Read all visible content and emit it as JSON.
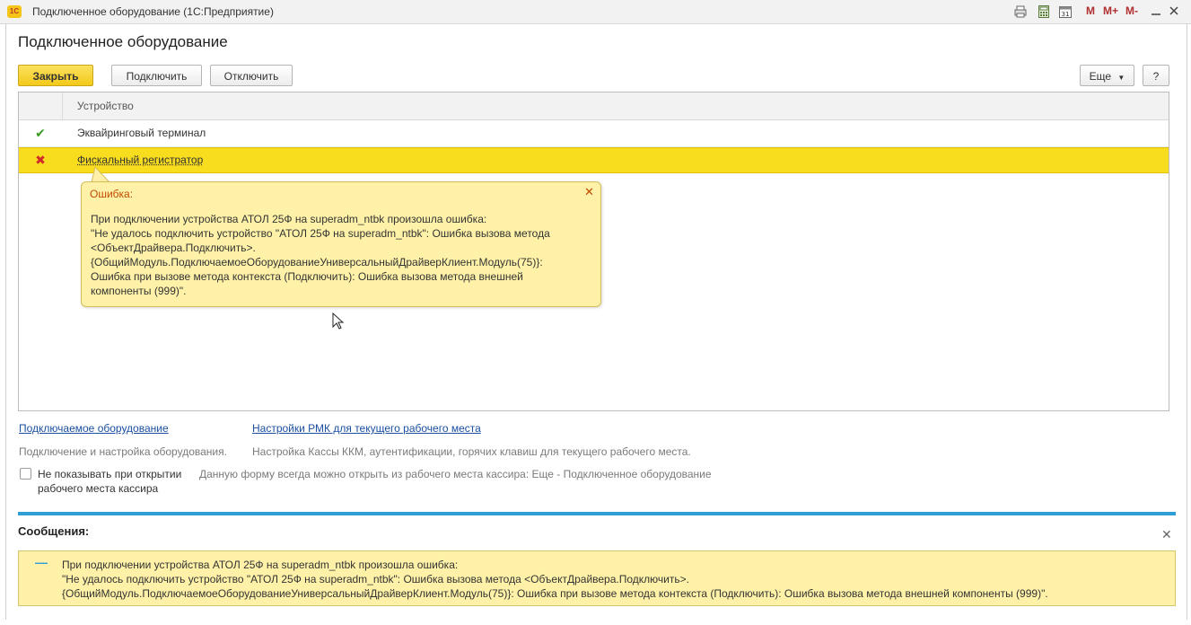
{
  "window": {
    "logo": "1С",
    "title": "Подключенное оборудование  (1С:Предприятие)",
    "toolbar_icons": [
      "print-icon",
      "calculator-icon",
      "calendar-icon"
    ],
    "toolbar_m": "M",
    "toolbar_mplus": "M+",
    "toolbar_mminus": "M-"
  },
  "form": {
    "title": "Подключенное оборудование"
  },
  "toolbar": {
    "close_label": "Закрыть",
    "connect_label": "Подключить",
    "disconnect_label": "Отключить",
    "more_label": "Еще",
    "help_label": "?"
  },
  "table": {
    "column_header": "Устройство",
    "rows": [
      {
        "status": "ok",
        "status_glyph": "✔",
        "name": "Эквайринговый терминал"
      },
      {
        "status": "error",
        "status_glyph": "✖",
        "name": "Фискальный регистратор"
      }
    ]
  },
  "tooltip": {
    "title": "Ошибка:",
    "body": "При подключении устройства АТОЛ 25Ф на superadm_ntbk произошла ошибка:\n\"Не удалось подключить устройство \"АТОЛ 25Ф на superadm_ntbk\": Ошибка вызова метода\n<ОбъектДрайвера.Подключить>.\n{ОбщийМодуль.ПодключаемоеОборудованиеУниверсальныйДрайверКлиент.Модуль(75)}:\nОшибка при вызове метода контекста (Подключить): Ошибка вызова метода внешней\nкомпоненты (999)\"."
  },
  "links": {
    "equipment_label": "Подключаемое оборудование",
    "equipment_note": "Подключение и настройка оборудования.",
    "rmk_label": "Настройки РМК для текущего рабочего места",
    "rmk_note": "Настройка Кассы ККМ, аутентификации, горячих клавиш для текущего рабочего места."
  },
  "option": {
    "checkbox_label": "Не показывать при открытии рабочего места кассира",
    "checked": false,
    "hint": "Данную форму всегда можно открыть из рабочего места кассира: Еще - Подключенное оборудование"
  },
  "messages": {
    "title": "Сообщения:",
    "text": "При подключении устройства АТОЛ 25Ф на superadm_ntbk произошла ошибка:\n\"Не удалось подключить устройство \"АТОЛ 25Ф на superadm_ntbk\": Ошибка вызова метода <ОбъектДрайвера.Подключить>.\n{ОбщийМодуль.ПодключаемоеОборудованиеУниверсальныйДрайверКлиент.Модуль(75)}: Ошибка при вызове метода контекста (Подключить): Ошибка вызова метода внешней компоненты (999)\"."
  },
  "colors": {
    "accent_yellow": "#f8dc1e",
    "message_blue": "#2f9dd6",
    "ok_green": "#3a9d23",
    "error_red": "#d02a2a"
  }
}
